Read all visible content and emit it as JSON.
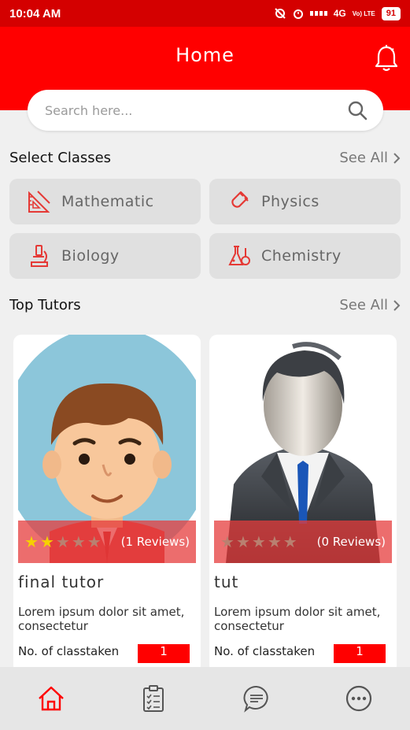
{
  "status_bar": {
    "time": "10:04 AM",
    "network": "4G",
    "carrier": "Vo) LTE",
    "battery": "91"
  },
  "header": {
    "title": "Home",
    "bell_icon": "bell-icon"
  },
  "search": {
    "placeholder": "Search here...",
    "icon": "search-icon"
  },
  "classes_section": {
    "title": "Select Classes",
    "see_all": "See All",
    "items": [
      {
        "label": "Mathematic",
        "icon": "ruler-triangle-icon"
      },
      {
        "label": "Physics",
        "icon": "magnet-icon"
      },
      {
        "label": "Biology",
        "icon": "microscope-icon"
      },
      {
        "label": "Chemistry",
        "icon": "flask-icon"
      }
    ]
  },
  "tutors_section": {
    "title": "Top Tutors",
    "see_all": "See All",
    "items": [
      {
        "name": "final tutor",
        "rating": 2,
        "reviews": "(1 Reviews)",
        "description": "Lorem ipsum dolor sit amet, consectetur",
        "classes_label": "No. of classtaken",
        "classes_count": "1"
      },
      {
        "name": "tut",
        "rating": 0,
        "reviews": "(0 Reviews)",
        "description": "Lorem ipsum dolor sit amet, consectetur",
        "classes_label": "No. of classtaken",
        "classes_count": "1"
      }
    ]
  },
  "bottom_nav": [
    {
      "name": "home",
      "icon": "home-icon",
      "active": true
    },
    {
      "name": "tasks",
      "icon": "clipboard-icon",
      "active": false
    },
    {
      "name": "messages",
      "icon": "chat-icon",
      "active": false
    },
    {
      "name": "more",
      "icon": "more-icon",
      "active": false
    }
  ],
  "colors": {
    "primary": "#ff0000",
    "status_bar": "#d40000",
    "star_on": "#f6d000",
    "inactive_icon": "#555555"
  }
}
